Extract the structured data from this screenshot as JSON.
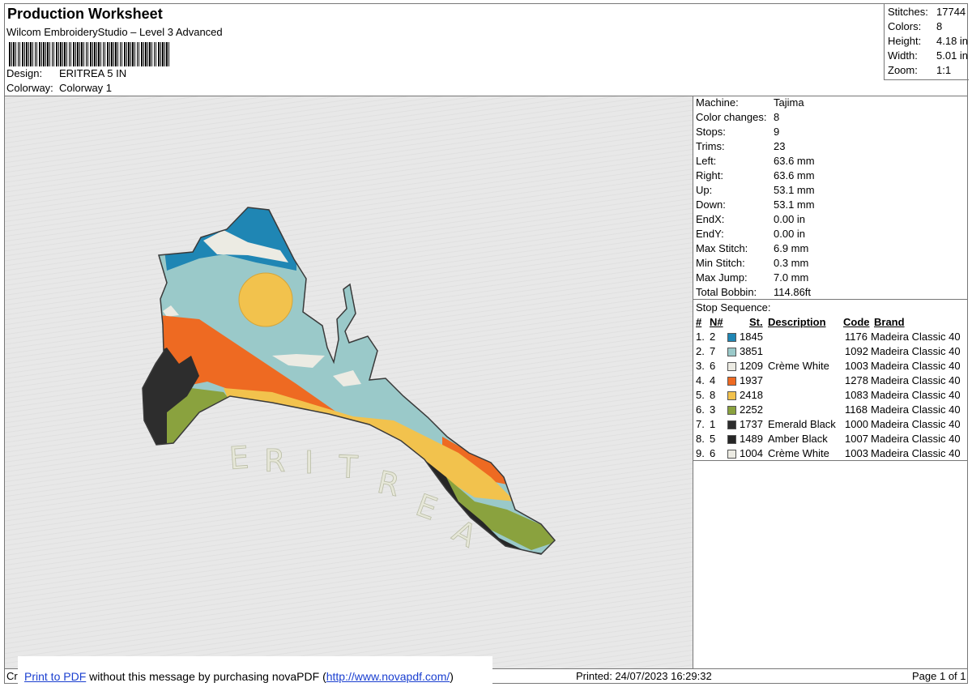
{
  "header": {
    "title": "Production Worksheet",
    "software": "Wilcom EmbroideryStudio – Level 3 Advanced",
    "design_label": "Design:",
    "design_value": "ERITREA 5 IN",
    "colorway_label": "Colorway:",
    "colorway_value": "Colorway 1"
  },
  "stats": [
    {
      "label": "Stitches:",
      "value": "17744"
    },
    {
      "label": "Colors:",
      "value": "8"
    },
    {
      "label": "Height:",
      "value": "4.18 in"
    },
    {
      "label": "Width:",
      "value": "5.01 in"
    },
    {
      "label": "Zoom:",
      "value": "1:1"
    }
  ],
  "machine_info": [
    {
      "label": "Machine:",
      "value": "Tajima"
    },
    {
      "label": "Color changes:",
      "value": "8"
    },
    {
      "label": "Stops:",
      "value": "9"
    },
    {
      "label": "Trims:",
      "value": "23"
    },
    {
      "label": "Left:",
      "value": "63.6 mm"
    },
    {
      "label": "Right:",
      "value": "63.6 mm"
    },
    {
      "label": "Up:",
      "value": "53.1 mm"
    },
    {
      "label": "Down:",
      "value": "53.1 mm"
    },
    {
      "label": "EndX:",
      "value": "0.00 in"
    },
    {
      "label": "EndY:",
      "value": "0.00 in"
    },
    {
      "label": "Max Stitch:",
      "value": "6.9 mm"
    },
    {
      "label": "Min Stitch:",
      "value": "0.3 mm"
    },
    {
      "label": "Max Jump:",
      "value": "7.0 mm"
    },
    {
      "label": "Total Bobbin:",
      "value": "114.86ft"
    }
  ],
  "stop_sequence": {
    "title": "Stop Sequence:",
    "headers": {
      "num": "#",
      "n": "N#",
      "st": "St.",
      "description": "Description",
      "code": "Code",
      "brand": "Brand"
    },
    "rows": [
      {
        "num": "1.",
        "n": "2",
        "color": "#1f86b4",
        "st": "1845",
        "description": "",
        "code": "1176",
        "brand": "Madeira Classic 40"
      },
      {
        "num": "2.",
        "n": "7",
        "color": "#9ac9c9",
        "st": "3851",
        "description": "",
        "code": "1092",
        "brand": "Madeira Classic 40"
      },
      {
        "num": "3.",
        "n": "6",
        "color": "#ecebe3",
        "st": "1209",
        "description": "Crème White",
        "code": "1003",
        "brand": "Madeira Classic 40"
      },
      {
        "num": "4.",
        "n": "4",
        "color": "#ee6a22",
        "st": "1937",
        "description": "",
        "code": "1278",
        "brand": "Madeira Classic 40"
      },
      {
        "num": "5.",
        "n": "8",
        "color": "#f2c24d",
        "st": "2418",
        "description": "",
        "code": "1083",
        "brand": "Madeira Classic 40"
      },
      {
        "num": "6.",
        "n": "3",
        "color": "#8aa23e",
        "st": "2252",
        "description": "",
        "code": "1168",
        "brand": "Madeira Classic 40"
      },
      {
        "num": "7.",
        "n": "1",
        "color": "#2d2d2d",
        "st": "1737",
        "description": "Emerald Black",
        "code": "1000",
        "brand": "Madeira Classic 40"
      },
      {
        "num": "8.",
        "n": "5",
        "color": "#262626",
        "st": "1489",
        "description": "Amber Black",
        "code": "1007",
        "brand": "Madeira Classic 40"
      },
      {
        "num": "9.",
        "n": "6",
        "color": "#ecebe3",
        "st": "1004",
        "description": "Crème White",
        "code": "1003",
        "brand": "Madeira Classic 40"
      }
    ]
  },
  "design_text": "ERITREA",
  "footer": {
    "cr": "Cr",
    "print_to_pdf": "Print to PDF",
    "nova_middle": " without this message by purchasing novaPDF (",
    "nova_url": "http://www.novapdf.com/",
    "nova_end": ")",
    "printed": "Printed: 24/07/2023 16:29:32",
    "page": "Page 1 of 1"
  }
}
